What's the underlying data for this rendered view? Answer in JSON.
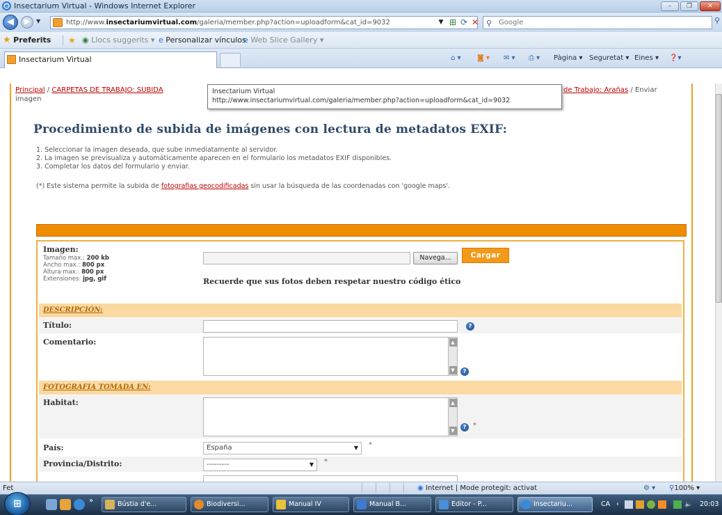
{
  "window": {
    "title": "Insectarium Virtual - Windows Internet Explorer"
  },
  "nav": {
    "address_prefix": "http://www.",
    "address_domain": "insectariumvirtual.com",
    "address_rest": "/galeria/member.php?action=uploadform&cat_id=9032",
    "search_placeholder": "Google"
  },
  "favbar": {
    "favorites": "Preferits",
    "items": [
      "Llocs suggerits ▾",
      "Personalizar vínculos",
      "Web Slice Gallery ▾"
    ]
  },
  "tab": {
    "title": "Insectarium Virtual"
  },
  "commands": {
    "page": "Pàgina ▾",
    "security": "Seguretat ▾",
    "tools": "Eines ▾"
  },
  "breadcrumb": {
    "home": "Principal",
    "sep": " / ",
    "folder": "CARPETAS DE TRABAJO: SUBIDA",
    "folder_end": "de Trabajo: Arañas",
    "current": " / Enviar",
    "current2": "imagen"
  },
  "tooltip": {
    "line1": "Insectarium Virtual",
    "line2": "http://www.insectariumvirtual.com/galeria/member.php?action=uploadform&cat_id=9032"
  },
  "content": {
    "heading": "Procedimiento de subida de imágenes con lectura de metadatos EXIF:",
    "steps": [
      "1. Seleccionar la imagen deseada, que sube inmediatamente al servidor.",
      "2. La imagen se previsualiza y automáticamente aparecen en el formulario los metadatos EXIF disponibles.",
      "3. Completar los datos del formulario y enviar."
    ],
    "note_prefix": "(*) Este sistema permite la subida de ",
    "note_link": "fotografias geocodificadas",
    "note_suffix": " sin usar la búsqueda de las coordenadas con 'google maps'."
  },
  "form": {
    "imagen": {
      "label": "Imagen:",
      "size_label": "Tamaño max.: ",
      "size_value": "200 kb",
      "width_label": "Ancho max.: ",
      "width_value": "800 px",
      "height_label": "Altura max.: ",
      "height_value": "800 px",
      "ext_label": "Extensiones: ",
      "ext_value": "jpg, gif",
      "browse": "Navega...",
      "upload": "Cargar",
      "ethics": "Recuerde que sus fotos deben respetar nuestro código ético"
    },
    "section_desc": "DESCRIPCIÓN:",
    "titulo": "Título:",
    "comentario": "Comentario:",
    "section_foto": "FOTOGRAFIA TOMADA EN:",
    "habitat": "Habitat:",
    "pais": "País:",
    "pais_value": "España",
    "provincia": "Provincia/Distrito:",
    "provincia_value": "---------",
    "asterisk": "*"
  },
  "status": {
    "left": "Fet",
    "zone": "Internet | Mode protegit: activat",
    "zoom": "100%"
  },
  "taskbar": {
    "buttons": [
      "Bústia d'e...",
      "Biodiversi...",
      "Manual IV",
      "Manual B...",
      "Editor - P...",
      "Insectariu..."
    ],
    "lang": "CA",
    "time": "20:03"
  }
}
